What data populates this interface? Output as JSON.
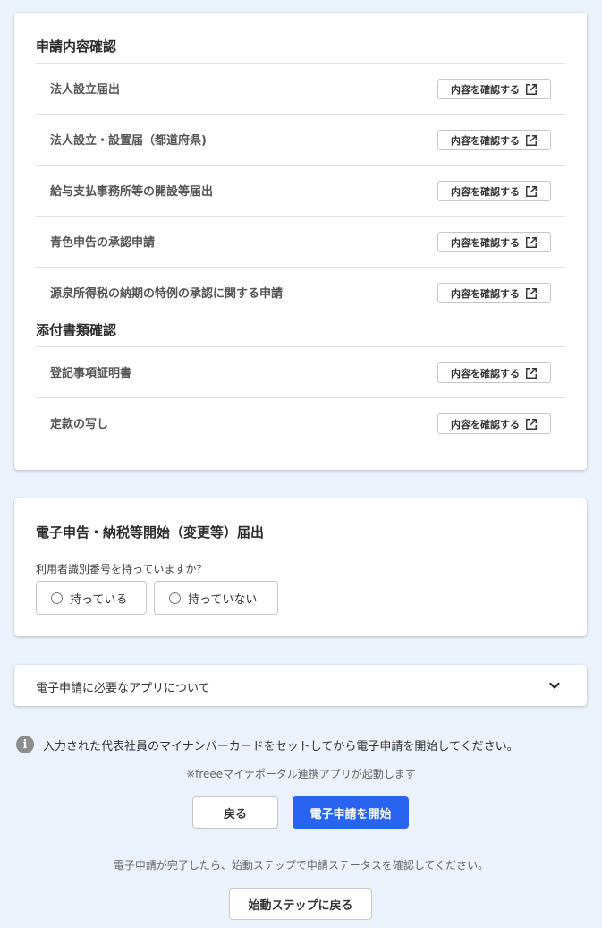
{
  "confirm": {
    "title": "申請内容確認",
    "button_label": "内容を確認する",
    "documents": [
      {
        "name": "法人設立届出"
      },
      {
        "name": "法人設立・設置届（都道府県)"
      },
      {
        "name": "給与支払事務所等の開設等届出"
      },
      {
        "name": "青色申告の承認申請"
      },
      {
        "name": "源泉所得税の納期の特例の承認に関する申請"
      }
    ],
    "attachments_title": "添付書類確認",
    "attachments": [
      {
        "name": "登記事項証明書"
      },
      {
        "name": "定款の写し"
      }
    ]
  },
  "esign": {
    "title": "電子申告・納税等開始（変更等）届出",
    "question": "利用者識別番号を持っていますか？",
    "option_yes": "持っている",
    "option_no": "持っていない"
  },
  "app_section": {
    "title": "電子申請に必要なアプリについて"
  },
  "info": {
    "message": "入力された代表社員のマイナンバーカードをセットしてから電子申請を開始してください。",
    "freee_note": "※freeeマイナポータル連携アプリが起動します",
    "done_note": "電子申請が完了したら、始動ステップで申請ステータスを確認してください。"
  },
  "buttons": {
    "back": "戻る",
    "start": "電子申請を開始",
    "return_step": "始動ステップに戻る"
  },
  "colors": {
    "background": "#ebf2fc",
    "primary": "#2864f0"
  }
}
